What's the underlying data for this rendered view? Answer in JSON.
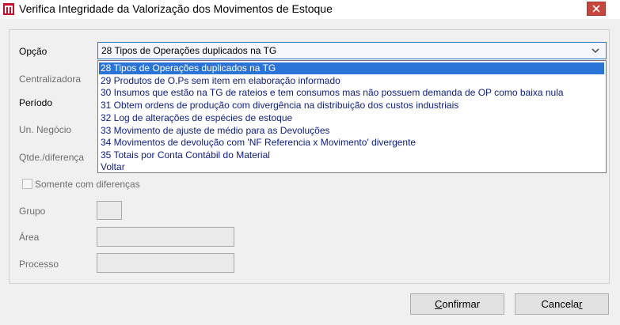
{
  "window": {
    "title": "Verifica Integridade da Valorização dos Movimentos de Estoque",
    "close_icon": "close-icon"
  },
  "form": {
    "opcao_label": "Opção",
    "centralizadora_label": "Centralizadora",
    "periodo_label": "Período",
    "un_negocio_label": "Un. Negócio",
    "qtde_label": "Qtde./diferença",
    "somente_label": "Somente com diferenças",
    "grupo_label": "Grupo",
    "area_label": "Área",
    "processo_label": "Processo"
  },
  "select": {
    "value": "28 Tipos de Operações duplicados na TG"
  },
  "dropdown": {
    "options": [
      "28 Tipos de Operações duplicados na TG",
      "29 Produtos de O.Ps sem item em elaboração informado",
      "30  Insumos que estão na TG de rateios e tem consumos mas não possuem demanda de OP como baixa nula",
      "31  Obtem ordens de produção com divergência na distribuição dos custos industriais",
      "32  Log de alterações de espécies de estoque",
      "33  Movimento de ajuste de médio para as Devoluções",
      "34  Movimentos de devolução com 'NF Referencia x Movimento' divergente",
      "35 Totais por Conta Contábil do Material",
      "Voltar"
    ]
  },
  "buttons": {
    "confirmar_first": "C",
    "confirmar_rest": "onfirmar",
    "cancelar_first": "Cancela",
    "cancelar_ul": "r"
  },
  "colors": {
    "selection": "#2a74d8",
    "option_text": "#0b1c8c",
    "close_button": "#c7453b"
  }
}
